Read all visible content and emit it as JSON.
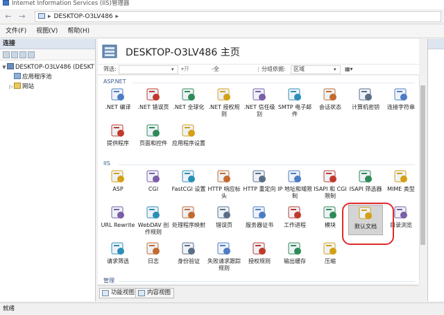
{
  "window": {
    "title": "Internet Information Services (IIS)管理器"
  },
  "address": {
    "path": "DESKTOP-O3LV486"
  },
  "menu": [
    "文件(F)",
    "视图(V)",
    "帮助(H)"
  ],
  "left_pane": {
    "header": "连接",
    "tree": [
      {
        "label": "DESKTOP-O3LV486 (DESKT",
        "expander": "▼",
        "icon": "server-icon",
        "level": 0
      },
      {
        "label": "应用程序池",
        "expander": "",
        "icon": "app-pool-icon",
        "level": 1
      },
      {
        "label": "网站",
        "expander": "▷",
        "icon": "sites-icon",
        "level": 1
      }
    ]
  },
  "header": {
    "title": "DESKTOP-O3LV486 主页"
  },
  "filter": {
    "label": "筛选:",
    "start": "开始(G)",
    "show_all": "全部显示(A)",
    "group_by": "分组依据:",
    "group_value": "区域"
  },
  "sections": [
    {
      "name": "ASP.NET",
      "items": [
        {
          "label": ".NET 编译",
          "icon": "net-compile-icon"
        },
        {
          "label": ".NET 错误页",
          "icon": "net-error-page-icon"
        },
        {
          "label": ".NET 全球化",
          "icon": "net-globalization-icon"
        },
        {
          "label": ".NET 授权规则",
          "icon": "net-authorization-icon"
        },
        {
          "label": ".NET 信任级别",
          "icon": "net-trust-icon"
        },
        {
          "label": "SMTP 电子邮件",
          "icon": "smtp-email-icon"
        },
        {
          "label": "会话状态",
          "icon": "session-state-icon"
        },
        {
          "label": "计算机密钥",
          "icon": "machine-key-icon"
        },
        {
          "label": "连接字符串",
          "icon": "connection-strings-icon"
        },
        {
          "label": "提供程序",
          "icon": "providers-icon"
        },
        {
          "label": "页面和控件",
          "icon": "pages-controls-icon"
        },
        {
          "label": "应用程序设置",
          "icon": "app-settings-icon"
        }
      ]
    },
    {
      "name": "IIS",
      "items": [
        {
          "label": "ASP",
          "icon": "asp-icon"
        },
        {
          "label": "CGI",
          "icon": "cgi-icon"
        },
        {
          "label": "FastCGI 设置",
          "icon": "fastcgi-icon"
        },
        {
          "label": "HTTP 响应标头",
          "icon": "http-headers-icon"
        },
        {
          "label": "HTTP 重定向",
          "icon": "http-redirect-icon"
        },
        {
          "label": "IP 地址和域限制",
          "icon": "ip-restrictions-icon"
        },
        {
          "label": "ISAPI 和 CGI 限制",
          "icon": "isapi-cgi-icon"
        },
        {
          "label": "ISAPI 筛选器",
          "icon": "isapi-filters-icon"
        },
        {
          "label": "MIME 类型",
          "icon": "mime-types-icon"
        },
        {
          "label": "URL Rewrite",
          "icon": "url-rewrite-icon"
        },
        {
          "label": "WebDAV 创作规则",
          "icon": "webdav-icon"
        },
        {
          "label": "处理程序映射",
          "icon": "handler-mappings-icon"
        },
        {
          "label": "错误页",
          "icon": "error-pages-icon"
        },
        {
          "label": "服务器证书",
          "icon": "server-certificates-icon"
        },
        {
          "label": "工作进程",
          "icon": "worker-processes-icon"
        },
        {
          "label": "模块",
          "icon": "modules-icon"
        },
        {
          "label": "默认文档",
          "icon": "default-document-icon",
          "selected": true
        },
        {
          "label": "目录浏览",
          "icon": "directory-browsing-icon"
        },
        {
          "label": "请求筛选",
          "icon": "request-filtering-icon"
        },
        {
          "label": "日志",
          "icon": "logging-icon"
        },
        {
          "label": "身份验证",
          "icon": "authentication-icon"
        },
        {
          "label": "失败请求跟踪规则",
          "icon": "failed-request-tracing-icon"
        },
        {
          "label": "授权规则",
          "icon": "authorization-rules-icon"
        },
        {
          "label": "输出缓存",
          "icon": "output-caching-icon"
        },
        {
          "label": "压缩",
          "icon": "compression-icon"
        }
      ]
    },
    {
      "name": "管理",
      "items": []
    }
  ],
  "view_tabs": [
    "功能视图",
    "内容视图"
  ],
  "status": "就绪",
  "colors": {
    "accent": "#3a5a8a",
    "highlight": "#e02a2a"
  }
}
